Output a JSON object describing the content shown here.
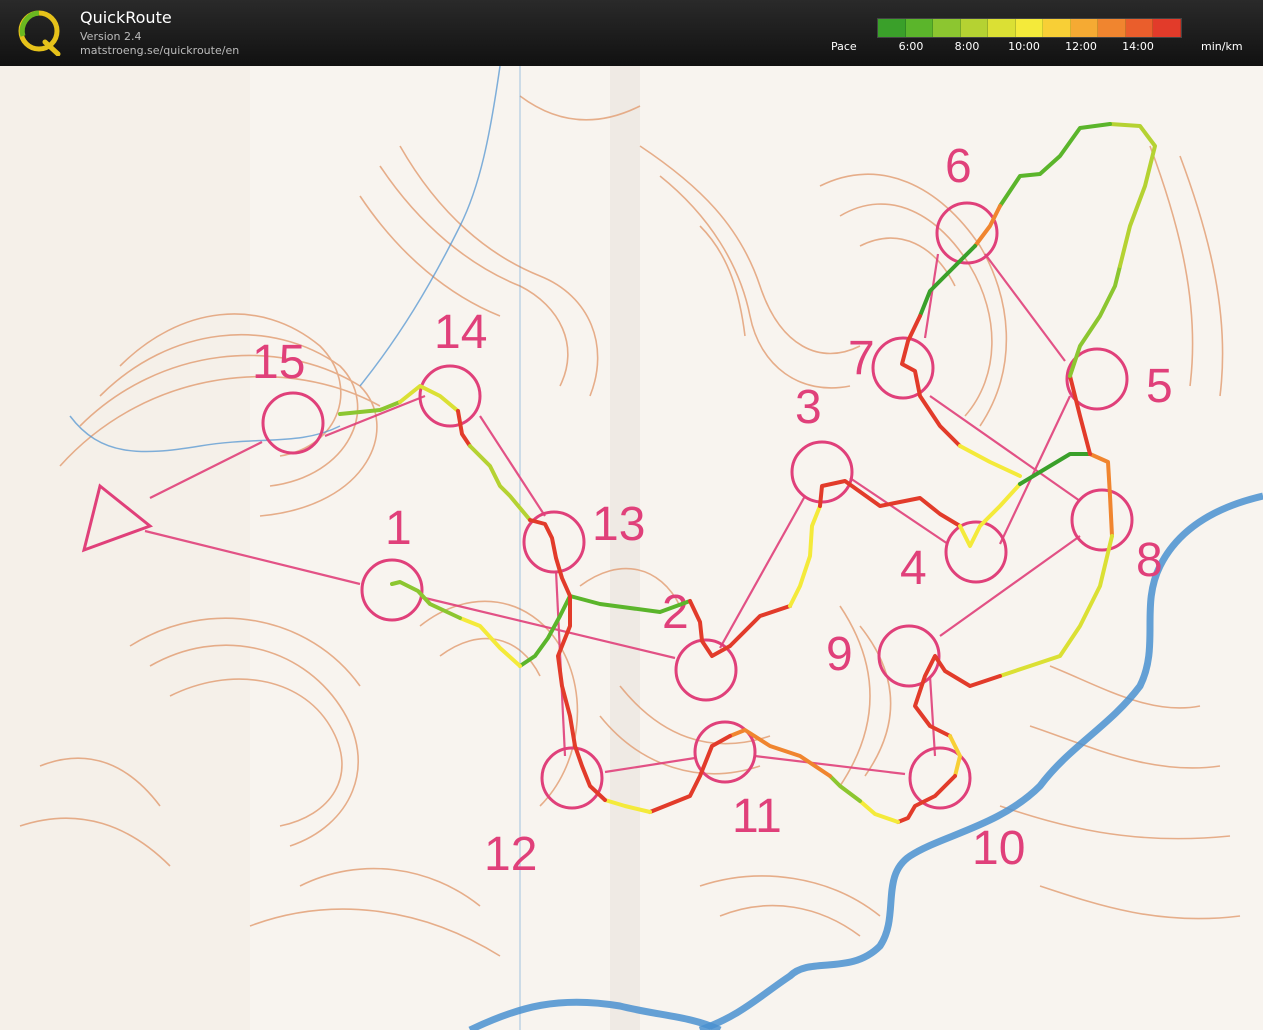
{
  "app": {
    "title": "QuickRoute",
    "version": "Version 2.4",
    "url": "matstroeng.se/quickroute/en"
  },
  "pace_legend": {
    "label": "Pace",
    "ticks": [
      "6:00",
      "8:00",
      "10:00",
      "12:00",
      "14:00"
    ],
    "unit": "min/km",
    "gradient_colors": [
      "#3aa02a",
      "#5bb52b",
      "#8cc630",
      "#b5d232",
      "#dbe034",
      "#f4ea3a",
      "#f8cf36",
      "#f5aa33",
      "#f0852f",
      "#ea5e2c",
      "#e23b2a"
    ]
  },
  "map": {
    "controls": [
      "1",
      "2",
      "3",
      "4",
      "5",
      "6",
      "7",
      "8",
      "9",
      "10",
      "11",
      "12",
      "13",
      "14",
      "15"
    ],
    "colors": {
      "course": "#e0407a",
      "contour": "#e09a6a",
      "water": "#4a90d0"
    }
  }
}
